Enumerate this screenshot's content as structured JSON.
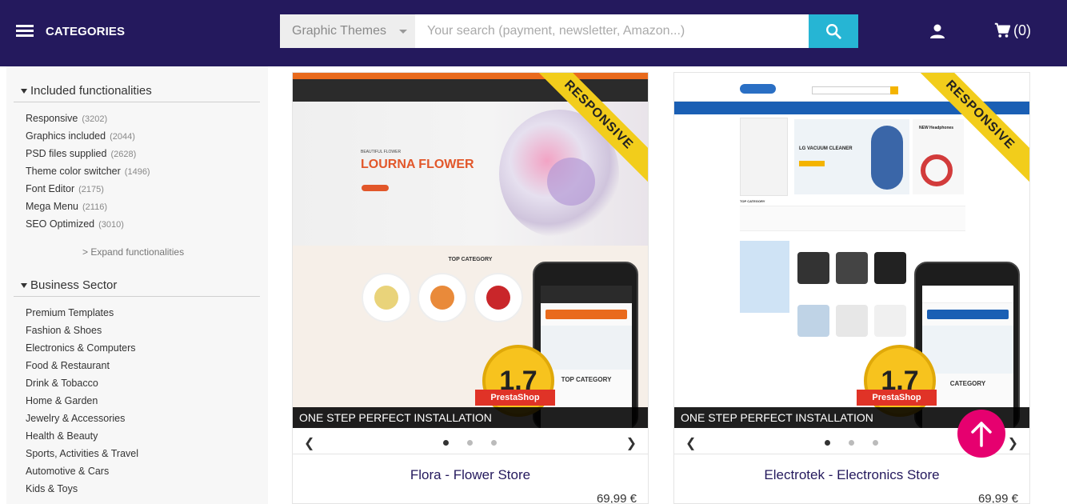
{
  "header": {
    "categories_label": "CATEGORIES",
    "search_type_value": "Graphic Themes",
    "search_placeholder": "Your search (payment, newsletter, Amazon...)",
    "cart_count": "(0)"
  },
  "sidebar": {
    "functionalities_title": "Included functionalities",
    "functionalities": [
      {
        "label": "Responsive",
        "count": "(3202)"
      },
      {
        "label": "Graphics included",
        "count": "(2044)"
      },
      {
        "label": "PSD files supplied",
        "count": "(2628)"
      },
      {
        "label": "Theme color switcher",
        "count": "(1496)"
      },
      {
        "label": "Font Editor",
        "count": "(2175)"
      },
      {
        "label": "Mega Menu",
        "count": "(2116)"
      },
      {
        "label": "SEO Optimized",
        "count": "(3010)"
      }
    ],
    "expand_label": "> Expand functionalities",
    "sector_title": "Business Sector",
    "sectors": [
      "Premium Templates",
      "Fashion & Shoes",
      "Electronics & Computers",
      "Food & Restaurant",
      "Drink & Tobacco",
      "Home & Garden",
      "Jewelry & Accessories",
      "Health & Beauty",
      "Sports, Activities & Travel",
      "Automotive & Cars",
      "Kids & Toys"
    ]
  },
  "products": [
    {
      "title": "Flora - Flower Store",
      "price": "69,99 €",
      "ribbon": "RESPONSIVE",
      "install_text": "ONE STEP PERFECT INSTALLATION",
      "version": "1.7",
      "platform": "PrestaShop",
      "preview_headline": "LOURNA FLOWER",
      "preview_kicker": "BEAUTIFUL FLOWER",
      "preview_section": "TOP CATEGORY",
      "phone_section": "TOP CATEGORY"
    },
    {
      "title": "Electrotek - Electronics Store",
      "price": "69,99 €",
      "ribbon": "RESPONSIVE",
      "install_text": "ONE STEP PERFECT INSTALLATION",
      "version": "1.7",
      "platform": "PrestaShop",
      "preview_headline": "LG VACUUM CLEANER",
      "preview_kicker": "NEW Headphones",
      "preview_section": "TOP CATEGORY",
      "phone_section": "CATEGORY"
    }
  ],
  "colors": {
    "header_bg": "#24195d",
    "search_button": "#26b5d4",
    "back_to_top": "#e6006f",
    "ribbon": "#f2cd1b"
  }
}
